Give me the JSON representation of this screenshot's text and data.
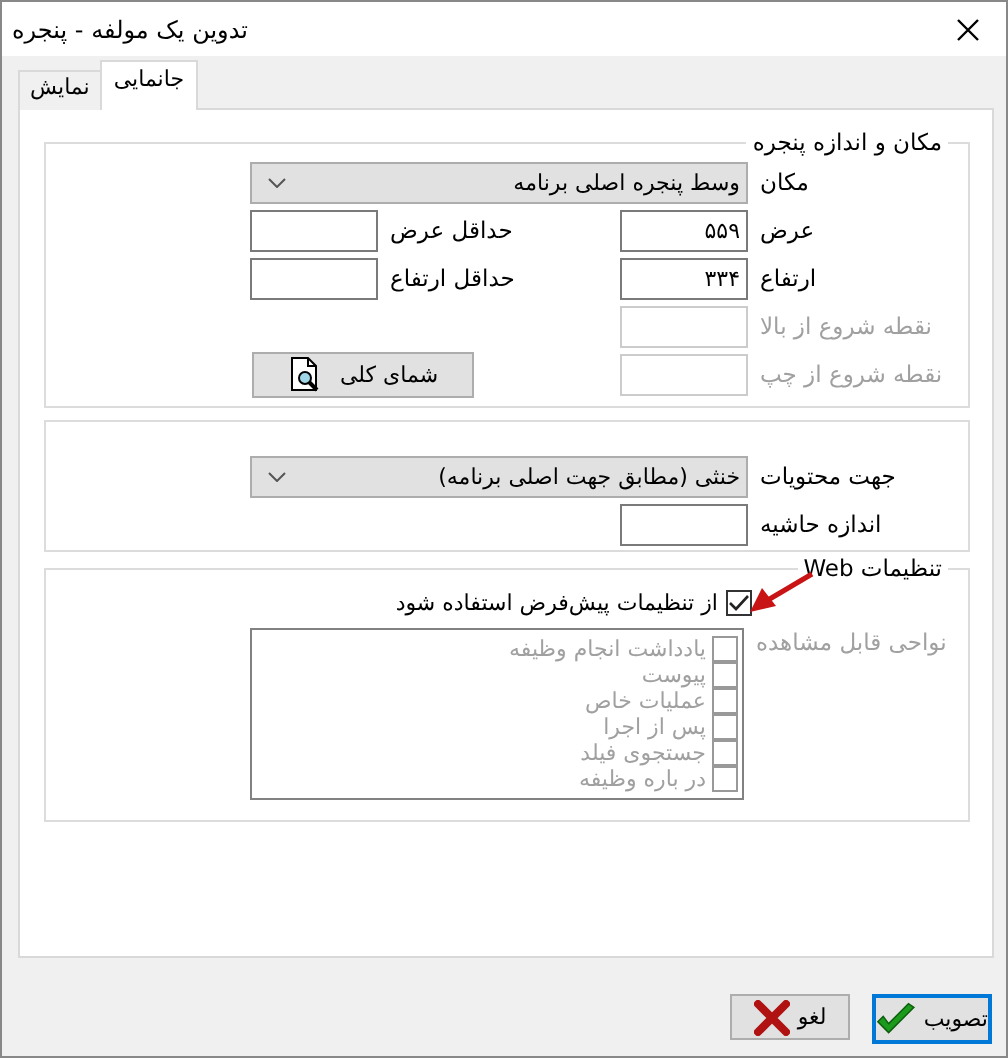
{
  "window": {
    "title": "تدوین یک مولفه - پنجره"
  },
  "tabs": [
    {
      "label": "جانمایی",
      "selected": true
    },
    {
      "label": "نمایش",
      "selected": false
    }
  ],
  "placement": {
    "legend": "مکان و اندازه پنجره",
    "position": {
      "label": "مکان",
      "value": "وسط پنجره اصلی برنامه"
    },
    "width": {
      "label": "عرض",
      "value": "۵۵۹"
    },
    "min_width": {
      "label": "حداقل عرض"
    },
    "height": {
      "label": "ارتفاع",
      "value": "۳۳۴"
    },
    "min_height": {
      "label": "حداقل ارتفاع"
    },
    "top": {
      "label": "نقطه شروع از بالا",
      "disabled": true
    },
    "left": {
      "label": "نقطه شروع از چپ",
      "disabled": true
    },
    "preview_button": "شمای کلی"
  },
  "content": {
    "direction": {
      "label": "جهت محتویات",
      "value": "خنثی (مطابق جهت اصلی برنامه)"
    },
    "margin": {
      "label": "اندازه حاشیه"
    }
  },
  "web": {
    "legend": "تنظیمات Web",
    "use_default": {
      "label": "از تنظیمات پیش‌فرض استفاده شود",
      "checked": true
    },
    "visible_areas": {
      "label": "نواحی قابل مشاهده",
      "disabled": true,
      "items": [
        {
          "label": "یادداشت انجام وظیفه",
          "checked": false
        },
        {
          "label": "پیوست",
          "checked": false
        },
        {
          "label": "عملیات خاص",
          "checked": false
        },
        {
          "label": "پس از اجرا",
          "checked": false
        },
        {
          "label": "جستجوی فیلد",
          "checked": false
        },
        {
          "label": "در باره وظیفه",
          "checked": false
        }
      ]
    }
  },
  "buttons": [
    {
      "label": "تصویب",
      "kind": "ok",
      "default": true
    },
    {
      "label": "لغو",
      "kind": "cancel",
      "default": false
    }
  ]
}
